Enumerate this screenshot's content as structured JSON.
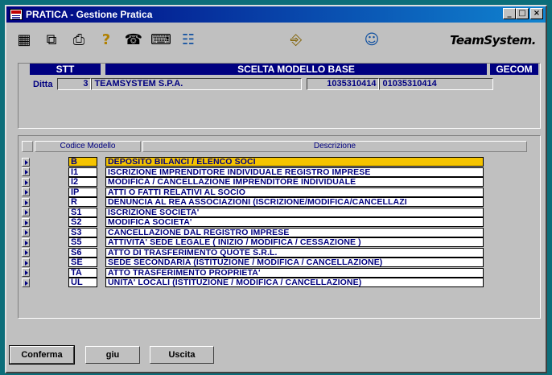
{
  "window": {
    "title": "PRATICA - Gestione Pratica",
    "controls": {
      "minimize": "_",
      "maximize": "□",
      "close": "×"
    }
  },
  "toolbar": {
    "icons": [
      {
        "name": "calculator-icon",
        "glyph": "▦"
      },
      {
        "name": "search-text-icon",
        "glyph": "⧉"
      },
      {
        "name": "printer-icon",
        "glyph": "⎙"
      },
      {
        "name": "help-icon",
        "glyph": "?"
      },
      {
        "name": "phone-icon",
        "glyph": "☎"
      },
      {
        "name": "keyboard-icon",
        "glyph": "⌨"
      },
      {
        "name": "network-icon",
        "glyph": "☷"
      },
      {
        "name": "exit-door-icon",
        "glyph": "⎆"
      },
      {
        "name": "support-person-icon",
        "glyph": "☺"
      }
    ],
    "logo": "TeamSystem."
  },
  "header": {
    "left_band": "STT",
    "center_band": "SCELTA MODELLO BASE",
    "right_band": "GECOM",
    "ditta_label": "Ditta",
    "ditta_code": "3",
    "ditta_name": "TEAMSYSTEM S.P.A.",
    "ditta_vat": "1035310414",
    "ditta_fiscal": "01035310414"
  },
  "table": {
    "columns": [
      "Codice Modello",
      "Descrizione"
    ],
    "selected_index": 0,
    "rows": [
      {
        "code": "B",
        "desc": "DEPOSITO BILANCI / ELENCO SOCI"
      },
      {
        "code": "I1",
        "desc": "ISCRIZIONE IMPRENDITORE INDIVIDUALE REGISTRO IMPRESE"
      },
      {
        "code": "I2",
        "desc": "MODIFICA / CANCELLAZIONE IMPRENDITORE INDIVIDUALE"
      },
      {
        "code": "IP",
        "desc": "ATTI O FATTI RELATIVI AL SOCIO"
      },
      {
        "code": "R",
        "desc": "DENUNCIA AL REA ASSOCIAZIONI (ISCRIZIONE/MODIFICA/CANCELLAZI"
      },
      {
        "code": "S1",
        "desc": "ISCRIZIONE SOCIETA'"
      },
      {
        "code": "S2",
        "desc": "MODIFICA SOCIETA'"
      },
      {
        "code": "S3",
        "desc": "CANCELLAZIONE DAL REGISTRO IMPRESE"
      },
      {
        "code": "S5",
        "desc": "ATTIVITA' SEDE LEGALE ( INIZIO / MODIFICA / CESSAZIONE )"
      },
      {
        "code": "S6",
        "desc": "ATTO DI TRASFERIMENTO QUOTE S.R.L."
      },
      {
        "code": "SE",
        "desc": "SEDE SECONDARIA (ISTITUZIONE / MODIFICA / CANCELLAZIONE)"
      },
      {
        "code": "TA",
        "desc": "ATTO TRASFERIMENTO PROPRIETA'"
      },
      {
        "code": "UL",
        "desc": "UNITA' LOCALI (ISTITUZIONE / MODIFICA / CANCELLAZIONE)"
      }
    ]
  },
  "buttons": {
    "confirm": "Conferma",
    "down": "giu",
    "exit": "Uscita"
  },
  "colors": {
    "desktop": "#0c6e7a",
    "title_bar": "#000080",
    "selection": "#f5c400",
    "text_accent": "#000080"
  }
}
